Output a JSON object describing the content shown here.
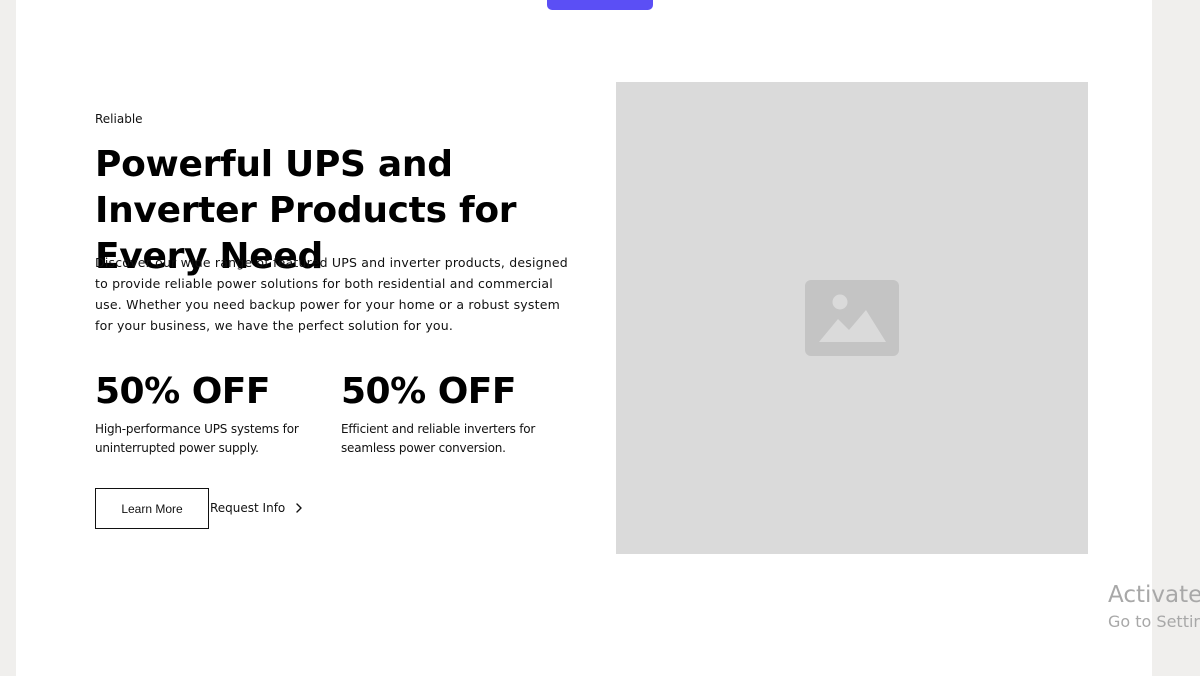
{
  "hero": {
    "eyebrow": "Reliable",
    "headline": "Powerful UPS and Inverter Products for Every Need",
    "description": "Discover our wide range of featured UPS and inverter products, designed to provide reliable power solutions for both residential and commercial use. Whether you need backup power for your home or a robust system for your business, we have the perfect solution for you.",
    "offers": [
      {
        "title": "50% OFF",
        "text": "High-performance UPS systems for uninterrupted power supply."
      },
      {
        "title": "50% OFF",
        "text": "Efficient and reliable inverters for seamless power conversion."
      }
    ],
    "learn_more_label": "Learn More",
    "request_info_label": "Request Info",
    "request_info_icon": "chevron-right-icon",
    "image_icon": "image-placeholder-icon"
  },
  "windows_watermark": {
    "title": "Activate",
    "subtitle": "Go to Settin"
  },
  "colors": {
    "accent": "#5b4ff5",
    "placeholder_bg": "#dadada",
    "page_bg": "#f0efed"
  }
}
